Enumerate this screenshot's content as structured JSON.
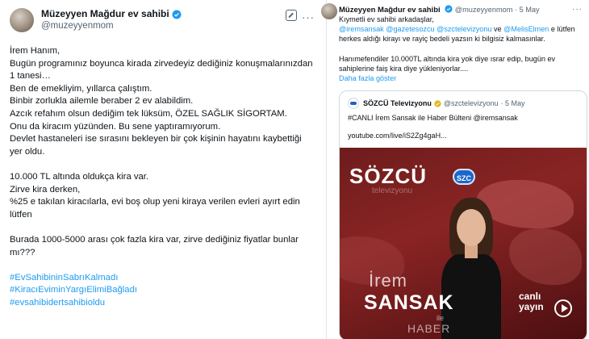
{
  "left_tweet": {
    "author_name": "Müzeyyen Mağdur ev sahibi",
    "handle": "@muzeyyenmom",
    "more": "···",
    "lines": [
      "İrem Hanım,",
      "Bugün programınız boyunca kirada zirvedeyiz dediğiniz konuşmalarınızdan 1 tanesi…",
      "Ben de emekliyim, yıllarca çalıştım.",
      "Binbir zorlukla ailemle beraber 2 ev alabildim.",
      "Azcık refahım olsun dediğim tek lüksüm, ÖZEL SAĞLIK SİGORTAM.",
      "Onu da kiracım yüzünden. Bu sene yaptıramıyorum.",
      "Devlet hastaneleri ise sırasını bekleyen bir çok kişinin hayatını kaybettiği yer oldu."
    ],
    "lines2": [
      "10.000 TL altında oldukça kira var.",
      "Zirve kira derken,",
      "%25 e takılan kiracılarla, evi boş olup yeni kiraya verilen evleri ayırt edin lütfen"
    ],
    "lines3": [
      "Burada 1000-5000 arası çok fazla kira var, zirve dediğiniz fiyatlar bunlar mı???"
    ],
    "hashtags": [
      "#EvSahibininSabrıKalmadı",
      "#KiracıEviminYargıElimiBağladı",
      "#evsahibidertsahibioldu"
    ]
  },
  "right_tweet": {
    "author_name": "Müzeyyen Mağdur ev sahibi",
    "handle": "@muzeyyenmom",
    "date": "· 5 May",
    "more": "···",
    "line1": "Kıymetli ev sahibi arkadaşlar,",
    "mention1": "@iremsansak",
    "mention2": "@gazetesozcu",
    "mention3": "@szctelevizyonu",
    "and": "ve",
    "mention4": "@MelisElmen",
    "line2_tail": "e lütfen herkes aldığı kirayı ve rayiç bedeli yazsın ki bilgisiz kalmasınlar.",
    "line3": "Hanımefendiler 10.000TL altında kira yok diye ısrar edip, bugün ev sahiplerine faiş kira diye yükleniyorlar....",
    "show_more": "Daha fazla göster"
  },
  "quoted": {
    "name": "SÖZCÜ Televizyonu",
    "handle": "@szctelevizyonu",
    "date": "· 5 May",
    "text": "#CANLI İrem Sansak ile Haber Bülteni @iremsansak",
    "link": "youtube.com/live/iS2Zg4gaH...",
    "media": {
      "brand": "SÖZCÜ",
      "brand_sub": "televizyonu",
      "logo": "SZC",
      "first_name": "İrem",
      "last_name": "SANSAK",
      "ile": "ile",
      "haber": "HABER",
      "live_line1": "canlı",
      "live_line2": "yayın"
    }
  },
  "colors": {
    "link": "#1d9bf0",
    "text": "#0f1419",
    "muted": "#536471"
  }
}
